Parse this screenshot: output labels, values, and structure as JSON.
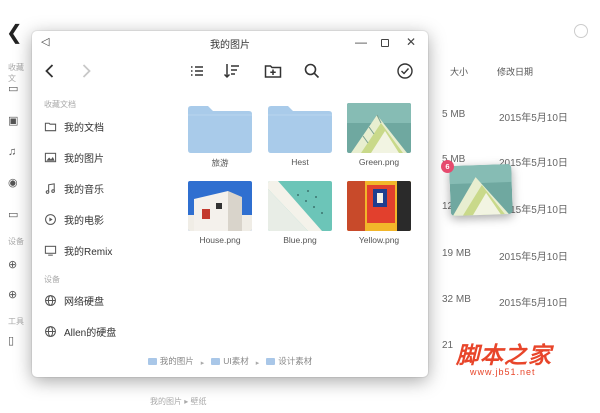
{
  "background_window": {
    "sidebar_labels": [
      "收藏文",
      "设备",
      "工具"
    ],
    "columns": {
      "size": "大小",
      "modified": "修改日期"
    },
    "rows": [
      {
        "size": "5 MB",
        "date": "2015年5月10日"
      },
      {
        "size": "5 MB",
        "date": "2015年5月10日"
      },
      {
        "size": "12",
        "date": "2015年5月10日"
      },
      {
        "size": "19 MB",
        "date": "2015年5月10日"
      },
      {
        "size": "32 MB",
        "date": "2015年5月10日"
      },
      {
        "size": "21",
        "date": ""
      }
    ],
    "footer_path": "我的图片 ▸ 壁纸"
  },
  "dialog": {
    "title": "我的图片",
    "sidebar": {
      "section_favorites": "收藏文档",
      "favorites": [
        {
          "label": "我的文档",
          "icon": "folder-icon"
        },
        {
          "label": "我的图片",
          "icon": "image-icon"
        },
        {
          "label": "我的音乐",
          "icon": "music-icon"
        },
        {
          "label": "我的电影",
          "icon": "movie-icon"
        },
        {
          "label": "我的Remix",
          "icon": "monitor-icon"
        }
      ],
      "section_devices": "设备",
      "devices": [
        {
          "label": "网络硬盘",
          "icon": "globe-icon"
        },
        {
          "label": "Allen的硬盘",
          "icon": "globe-icon"
        }
      ]
    },
    "files": [
      {
        "name": "旅游",
        "kind": "folder"
      },
      {
        "name": "Hest",
        "kind": "folder"
      },
      {
        "name": "Green.png",
        "kind": "image"
      },
      {
        "name": "House.png",
        "kind": "image"
      },
      {
        "name": "Blue.png",
        "kind": "image"
      },
      {
        "name": "Yellow.png",
        "kind": "image"
      }
    ],
    "breadcrumb": [
      "我的图片",
      "UI素材",
      "设计素材"
    ]
  },
  "drag": {
    "badge_count": "6"
  },
  "watermark": {
    "title": "脚本之家",
    "url": "www.jb51.net"
  },
  "colors": {
    "folder": "#a9cbea",
    "accent_badge": "#e64a6e",
    "watermark": "#e8452a"
  }
}
